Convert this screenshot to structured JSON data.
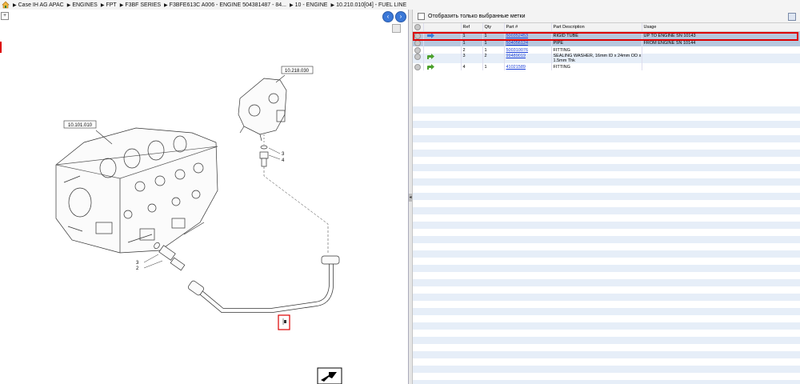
{
  "breadcrumb": {
    "items": [
      "Case IH AG APAC",
      "ENGINES",
      "FPT",
      "F3BF SERIES",
      "F3BFE613C A006 - ENGINE 504381487 - 84...",
      "10 - ENGINE",
      "10.210.010[04] - FUEL LINE"
    ]
  },
  "diagram": {
    "callouts": {
      "top_ref": "10.218.030",
      "left_ref": "10.101.010",
      "n3a": "3",
      "n4": "4",
      "n3b": "3",
      "n2": "2"
    }
  },
  "filter": {
    "label": "Отобразить только выбранные метки"
  },
  "table": {
    "headers": [
      "",
      "",
      "Ref",
      "Qty",
      "Part #",
      "Part Description",
      "Usage"
    ],
    "rows": [
      {
        "ref": "1",
        "qty": "1",
        "part": "500352453",
        "desc": "RIGID TUBE",
        "desc2": "",
        "usage": "UP TO ENGINE SN 10143"
      },
      {
        "ref": "1",
        "qty": "1",
        "part": "504056124",
        "desc": "PIPE",
        "desc2": "",
        "usage": "FROM ENGINE SN 10144"
      },
      {
        "ref": "2",
        "qty": "1",
        "part": "500310076",
        "desc": "FITTING",
        "desc2": "",
        "usage": ""
      },
      {
        "ref": "3",
        "qty": "2",
        "part": "99489019",
        "desc": "SEALING WASHER, 16mm ID x 24mm OD x",
        "desc2": "1.5mm Thk",
        "usage": ""
      },
      {
        "ref": "4",
        "qty": "1",
        "part": "41021589",
        "desc": "FITTING",
        "desc2": "",
        "usage": ""
      }
    ]
  },
  "colors": {
    "selected_row": "#b6c8de",
    "highlight_red": "#d00000",
    "link": "#1a3fd8"
  }
}
